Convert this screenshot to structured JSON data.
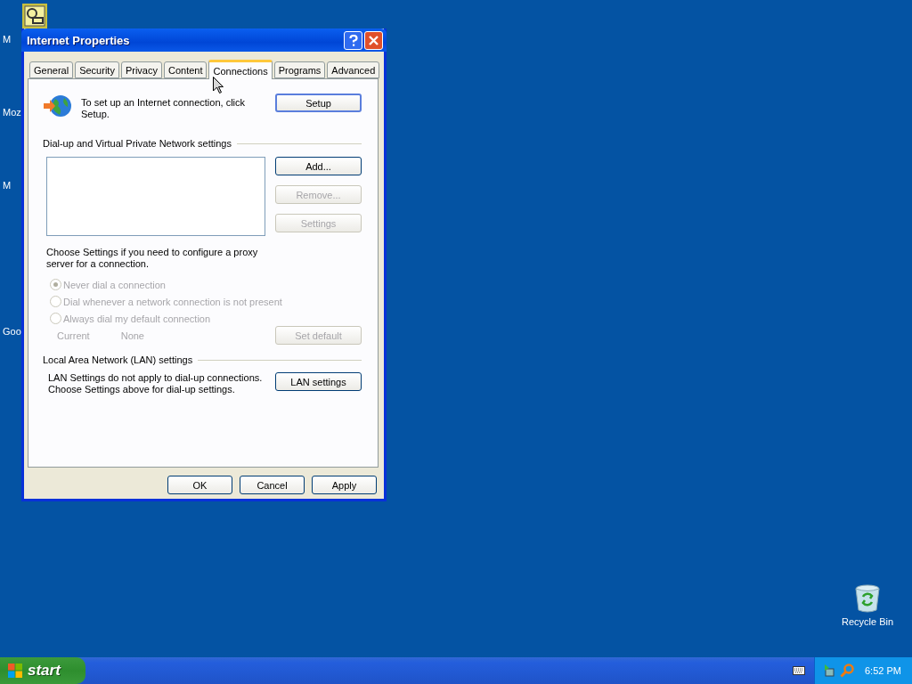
{
  "desktop": {
    "icon_labels": [
      "M",
      "Moz",
      "M",
      "Goo"
    ]
  },
  "window": {
    "title": "Internet Properties"
  },
  "tabs": [
    {
      "label": "General",
      "selected": false
    },
    {
      "label": "Security",
      "selected": false
    },
    {
      "label": "Privacy",
      "selected": false
    },
    {
      "label": "Content",
      "selected": false
    },
    {
      "label": "Connections",
      "selected": true
    },
    {
      "label": "Programs",
      "selected": false
    },
    {
      "label": "Advanced",
      "selected": false
    }
  ],
  "setup": {
    "text": "To set up an Internet connection, click Setup.",
    "button": "Setup"
  },
  "dialup": {
    "heading": "Dial-up and Virtual Private Network settings",
    "buttons": [
      {
        "label": "Add...",
        "disabled": false
      },
      {
        "label": "Remove...",
        "disabled": true
      },
      {
        "label": "Settings",
        "disabled": true
      }
    ]
  },
  "proxy_note": "Choose Settings if you need to configure a proxy server for a connection.",
  "dial_options": [
    {
      "label": "Never dial a connection",
      "selected": true,
      "disabled": true
    },
    {
      "label": "Dial whenever a network connection is not present",
      "selected": false,
      "disabled": true
    },
    {
      "label": "Always dial my default connection",
      "selected": false,
      "disabled": true
    }
  ],
  "current": {
    "label": "Current",
    "value": "None",
    "disabled": true
  },
  "set_default": {
    "label": "Set default",
    "disabled": true
  },
  "lan": {
    "heading": "Local Area Network (LAN) settings",
    "text": "LAN Settings do not apply to dial-up connections. Choose Settings above for dial-up settings.",
    "button": "LAN settings"
  },
  "footer_buttons": [
    "OK",
    "Cancel",
    "Apply"
  ],
  "recycle_bin": {
    "label": "Recycle Bin"
  },
  "taskbar": {
    "start": "start",
    "clock": "6:52 PM"
  }
}
